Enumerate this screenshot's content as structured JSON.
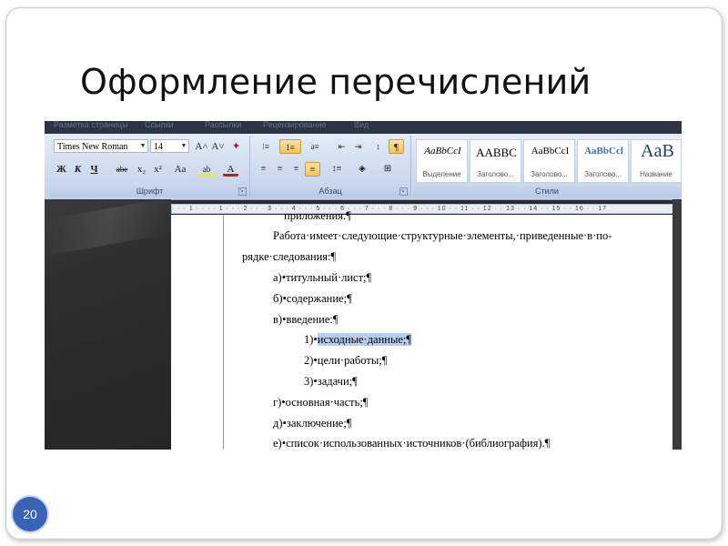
{
  "slide": {
    "title": "Оформление перечислений",
    "number": "20"
  },
  "word": {
    "tabs": [
      "Разметка страницы",
      "Ссылки",
      "Рассылки",
      "Рецензирование",
      "Вид"
    ],
    "font": {
      "name": "Times New Roman",
      "size": "14",
      "group_label": "Шрифт",
      "grow": "A˄",
      "shrink": "A˅",
      "clear": "✦",
      "bold": "Ж",
      "italic": "К",
      "underline": "Ч",
      "strike": "abe",
      "subscript": "x₂",
      "superscript": "x²",
      "case": "Aa",
      "highlight": "ab",
      "color": "A"
    },
    "paragraph": {
      "group_label": "Абзац",
      "pilcrow": "¶"
    },
    "styles": {
      "group_label": "Стили",
      "items": [
        {
          "sample": "AaBbCcI",
          "name": "Выделение"
        },
        {
          "sample": "AABBC",
          "name": "Заголово..."
        },
        {
          "sample": "AaBbCcI",
          "name": "Заголово..."
        },
        {
          "sample": "AaBbCcl",
          "name": "Заголово..."
        },
        {
          "sample": "AaB",
          "name": "Название"
        }
      ]
    },
    "ruler": "· · · 1 · · · · 1 · · · 2 · · · 3 · · · 4 · · · 5 · · · 6 · · · 7 · · · 8 · · · 9 · · · 10 · · 11 · · 12 · · 13 · · 14 · · 15 · · 16 · · 17",
    "document": {
      "line_top_fragment": "приложения.¶",
      "para1_line1": "Работа·имеет·следующие·структурные·элементы,·приведенные·в·по-",
      "para1_line2": "рядке·следования:¶",
      "item_a": "а)•титульный·лист;¶",
      "item_b": "б)•содержание;¶",
      "item_v": "в)•введение:¶",
      "sub1_num": "1)•",
      "sub1_text": "исходные·данные;¶",
      "sub2": "2)•цели·работы;¶",
      "sub3": "3)•задачи;¶",
      "item_g": "г)•основная·часть;¶",
      "item_d": "д)•заключение;¶",
      "item_e": "е)•список·использованных·источников·(библиография).¶"
    }
  }
}
